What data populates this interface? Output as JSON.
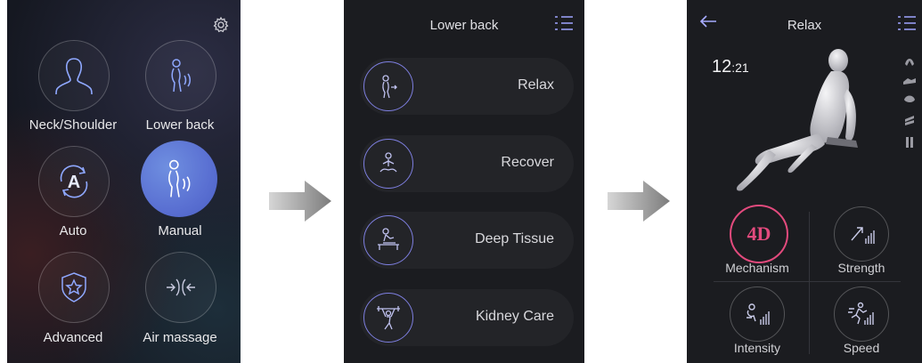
{
  "screen1": {
    "items": [
      {
        "label": "Neck/Shoulder",
        "icon": "head-shoulders-icon"
      },
      {
        "label": "Lower back",
        "icon": "lower-back-icon"
      },
      {
        "label": "Auto",
        "icon": "auto-icon",
        "glyph": "A"
      },
      {
        "label": "Manual",
        "icon": "manual-icon",
        "active": true
      },
      {
        "label": "Advanced",
        "icon": "shield-star-icon"
      },
      {
        "label": "Air massage",
        "icon": "air-massage-icon"
      }
    ],
    "settings_icon": "gear-icon",
    "accent": "#5a70d2"
  },
  "screen2": {
    "title": "Lower back",
    "programs": [
      {
        "label": "Relax",
        "icon": "relax-icon"
      },
      {
        "label": "Recover",
        "icon": "meditation-icon"
      },
      {
        "label": "Deep Tissue",
        "icon": "massage-table-icon"
      },
      {
        "label": "Kidney Care",
        "icon": "weightlifter-icon"
      }
    ],
    "menu_icon": "list-menu-icon",
    "accent": "#7e7fe0"
  },
  "screen3": {
    "title": "Relax",
    "timer_minutes": "12",
    "timer_sep": ":",
    "timer_seconds": "21",
    "metrics": [
      {
        "label": "Mechanism",
        "value": "4D",
        "icon": "4d-icon"
      },
      {
        "label": "Strength",
        "icon": "strength-icon"
      },
      {
        "label": "Intensity",
        "icon": "intensity-icon"
      },
      {
        "label": "Speed",
        "icon": "speed-icon"
      }
    ],
    "accent": "#e24a7d"
  }
}
